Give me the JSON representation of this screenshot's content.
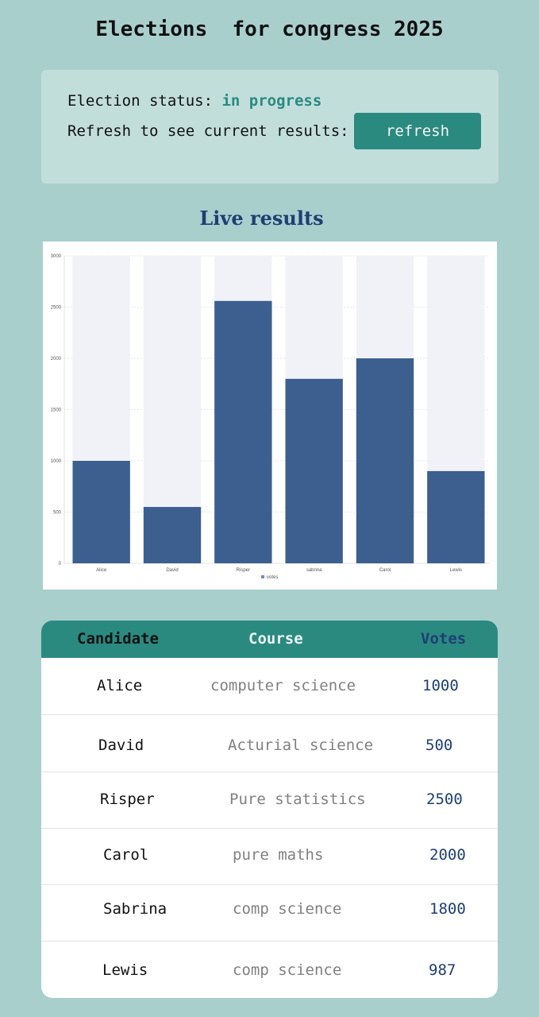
{
  "page": {
    "title": "Elections  for congress 2025"
  },
  "status": {
    "label": "Election status: ",
    "value": "in progress",
    "refresh_text": "Refresh to see current results:",
    "refresh_button": "refresh"
  },
  "chart_section": {
    "title": "Live results"
  },
  "chart_data": {
    "type": "bar",
    "categories": [
      "Alice",
      "David",
      "Risper",
      "sabrina",
      "Carol",
      "Lewis"
    ],
    "series": [
      {
        "name": "votes",
        "values": [
          1000,
          550,
          2560,
          1800,
          2000,
          900
        ]
      }
    ],
    "ylim": [
      0,
      3000
    ],
    "yticks": [
      "0",
      "500",
      "1000",
      "1500",
      "2000",
      "2500",
      "3000"
    ],
    "legend": "bottom",
    "grid": true,
    "bar_color": "#3c5f8f",
    "track_color": "#f1f2f8"
  },
  "table": {
    "headers": {
      "candidate": "Candidate",
      "course": "Course",
      "votes": "Votes"
    },
    "rows": [
      {
        "name": "Alice",
        "course": "computer science",
        "votes": "1000"
      },
      {
        "name": "David",
        "course": "Acturial science",
        "votes": "500"
      },
      {
        "name": "Risper",
        "course": "Pure statistics",
        "votes": "2500"
      },
      {
        "name": "Carol",
        "course": "pure maths",
        "votes": "2000"
      },
      {
        "name": "Sabrina",
        "course": "comp science",
        "votes": "1800"
      },
      {
        "name": "Lewis",
        "course": "comp science",
        "votes": "987"
      }
    ]
  },
  "colors": {
    "background": "#a9cfcd",
    "card": "#c2dedb",
    "accent": "#2a8a80",
    "navy": "#1e3f73"
  }
}
